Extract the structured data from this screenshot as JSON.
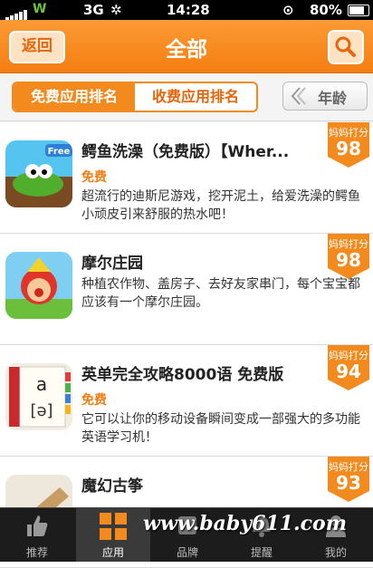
{
  "status": {
    "carrier": "3G",
    "time": "14:28",
    "battery": "80%"
  },
  "header": {
    "back_label": "返回",
    "title": "全部",
    "search_icon": "search-icon"
  },
  "tabs": [
    {
      "label": "免费应用排名",
      "active": true
    },
    {
      "label": "收费应用排名",
      "active": false
    }
  ],
  "filter": {
    "label": "年龄"
  },
  "apps": [
    {
      "name": "鳄鱼洗澡（免费版）【Wher...",
      "price": "免费",
      "desc": "超流行的迪斯尼游戏，挖开泥土，给爱洗澡的鳄鱼小顽皮引来舒服的热水吧！",
      "score_caption": "妈妈打分",
      "score": "98",
      "icon_badge": "Free"
    },
    {
      "name": "摩尔庄园",
      "price": "",
      "desc": "种植农作物、盖房子、去好友家串门，每个宝宝都应该有一个摩尔庄园。",
      "score_caption": "妈妈打分",
      "score": "98"
    },
    {
      "name": "英单完全攻略8000语 免费版",
      "price": "免费",
      "desc": "它可以让你的移动设备瞬间变成一部强大的多功能英语学习机！",
      "score_caption": "妈妈打分",
      "score": "94",
      "icon_text": "a",
      "icon_phonetic": "[ə]"
    },
    {
      "name": "魔幻古筝",
      "price": "",
      "desc": "",
      "score_caption": "妈妈打分",
      "score": "93"
    }
  ],
  "tabbar": [
    {
      "label": "推荐",
      "icon": "thumbs-up-icon"
    },
    {
      "label": "应用",
      "icon": "grid-icon",
      "active": true
    },
    {
      "label": "品牌",
      "icon": "brand-icon"
    },
    {
      "label": "提醒",
      "icon": "bell-icon"
    },
    {
      "label": "我的",
      "icon": "user-icon"
    }
  ],
  "watermark": "www.baby611.com"
}
